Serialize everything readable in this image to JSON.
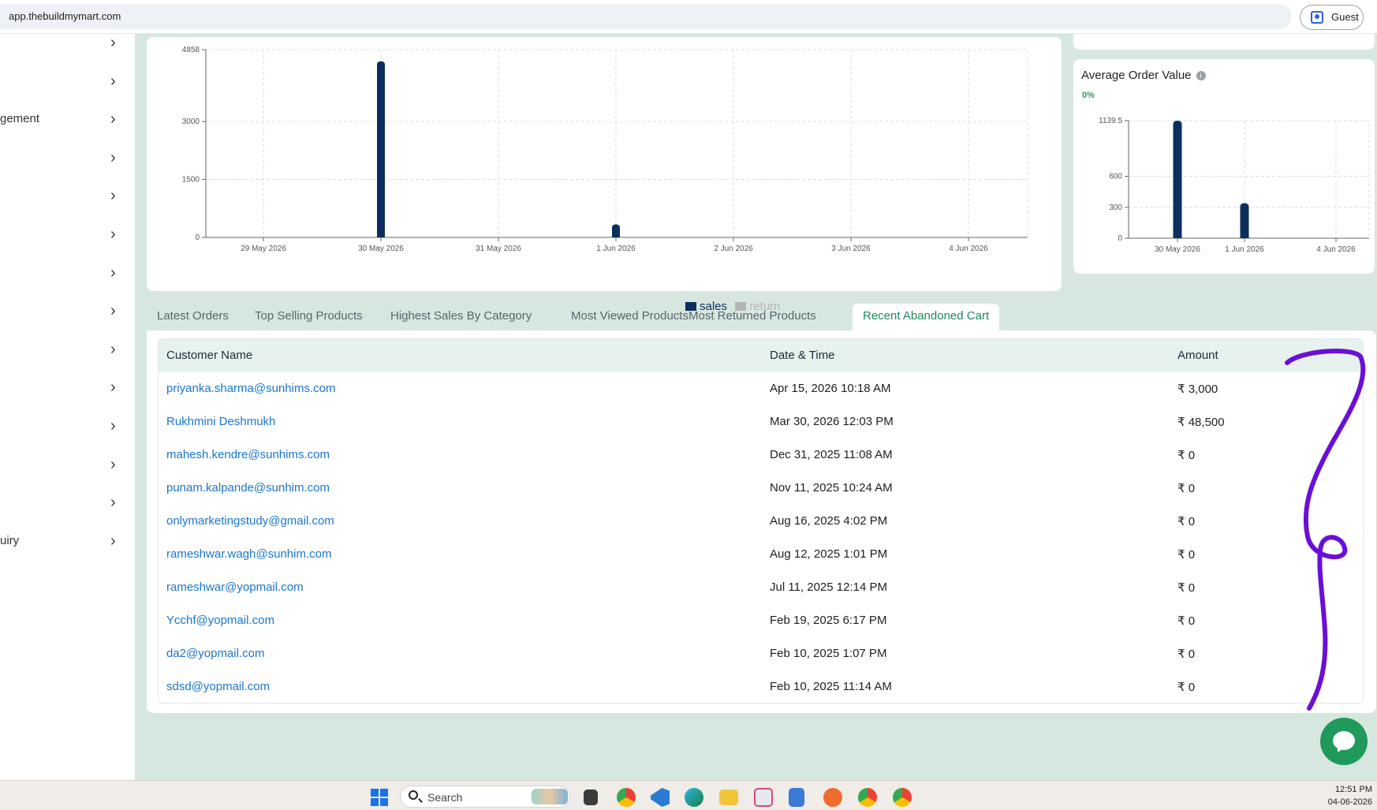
{
  "browser": {
    "url": "app.thebuildmymart.com",
    "profile_label": "Guest",
    "profile_icon": "person-badge-icon"
  },
  "sidebar": {
    "items": [
      {
        "label": ""
      },
      {
        "label": ""
      },
      {
        "label": "gement"
      },
      {
        "label": ""
      },
      {
        "label": ""
      },
      {
        "label": ""
      },
      {
        "label": ""
      },
      {
        "label": ""
      },
      {
        "label": ""
      },
      {
        "label": ""
      },
      {
        "label": ""
      },
      {
        "label": ""
      },
      {
        "label": ""
      },
      {
        "label": "uiry"
      }
    ],
    "chevron": "chevron-right-icon"
  },
  "sales_chart": {
    "legend": [
      {
        "label": "sales",
        "color": "#0d2f5e"
      },
      {
        "label": "return",
        "color": "#b5b5b5"
      }
    ]
  },
  "aov_card": {
    "title": "Average Order Value",
    "change": "0%"
  },
  "chart_data": [
    {
      "type": "bar",
      "categories": [
        "29 May 2026",
        "30 May 2026",
        "31 May 2026",
        "1 Jun 2026",
        "2 Jun 2026",
        "3 Jun 2026",
        "4 Jun 2026"
      ],
      "series": [
        {
          "name": "sales",
          "values": [
            0,
            4560,
            0,
            340,
            0,
            0,
            0
          ]
        },
        {
          "name": "return",
          "values": [
            0,
            0,
            0,
            0,
            0,
            0,
            0
          ]
        }
      ],
      "yticks": [
        "0",
        "1500",
        "3000",
        "4858"
      ],
      "ylim": [
        0,
        4858
      ],
      "grid": true,
      "legend": "bottom",
      "colors": {
        "sales": "#0d2f5e",
        "return": "#b5b5b5"
      }
    },
    {
      "type": "bar",
      "categories": [
        "30 May 2026",
        "1 Jun 2026",
        "4 Jun 2026"
      ],
      "values": [
        1139.5,
        340,
        0
      ],
      "yticks": [
        "0",
        "300",
        "600",
        "1139.5"
      ],
      "ylim": [
        0,
        1139.5
      ],
      "grid": true,
      "color": "#0d2f5e"
    }
  ],
  "tabs": [
    {
      "label": "Latest Orders",
      "active": false
    },
    {
      "label": "Top Selling Products",
      "active": false
    },
    {
      "label": "Highest Sales By Category",
      "active": false
    },
    {
      "label": "Most Viewed Products",
      "active": false
    },
    {
      "label": "Most Returned Products",
      "active": false
    },
    {
      "label": "Recent Abandoned Cart",
      "active": true
    }
  ],
  "abandoned_cart": {
    "columns": [
      "Customer Name",
      "Date & Time",
      "Amount"
    ],
    "rows": [
      {
        "customer": "priyanka.sharma@sunhims.com",
        "datetime": "Apr 15, 2026 10:18 AM",
        "amount": "₹ 3,000"
      },
      {
        "customer": "Rukhmini Deshmukh",
        "datetime": "Mar 30, 2026 12:03 PM",
        "amount": "₹ 48,500"
      },
      {
        "customer": "mahesh.kendre@sunhims.com",
        "datetime": "Dec 31, 2025 11:08 AM",
        "amount": "₹ 0"
      },
      {
        "customer": "punam.kalpande@sunhim.com",
        "datetime": "Nov 11, 2025 10:24 AM",
        "amount": "₹ 0"
      },
      {
        "customer": "onlymarketingstudy@gmail.com",
        "datetime": "Aug 16, 2025 4:02 PM",
        "amount": "₹ 0"
      },
      {
        "customer": "rameshwar.wagh@sunhim.com",
        "datetime": "Aug 12, 2025 1:01 PM",
        "amount": "₹ 0"
      },
      {
        "customer": "rameshwar@yopmail.com",
        "datetime": "Jul 11, 2025 12:14 PM",
        "amount": "₹ 0"
      },
      {
        "customer": "Ycchf@yopmail.com",
        "datetime": "Feb 19, 2025 6:17 PM",
        "amount": "₹ 0"
      },
      {
        "customer": "da2@yopmail.com",
        "datetime": "Feb 10, 2025 1:07 PM",
        "amount": "₹ 0"
      },
      {
        "customer": "sdsd@yopmail.com",
        "datetime": "Feb 10, 2025 11:14 AM",
        "amount": "₹ 0"
      }
    ]
  },
  "annotation": {
    "color": "#6a0fd8"
  },
  "chat": {
    "icon": "chat-bubble-icon",
    "color": "#1f9a5a"
  },
  "taskbar": {
    "search_label": "Search",
    "time": "12:51 PM",
    "date": "04-06-2026",
    "icons": [
      "windows-start-icon",
      "search-icon",
      "task-view-icon",
      "chrome-icon",
      "vscode-icon",
      "edge-icon",
      "file-explorer-icon",
      "snipping-tool-icon",
      "notepad-icon",
      "postman-icon",
      "chrome-icon",
      "chrome-icon"
    ]
  }
}
